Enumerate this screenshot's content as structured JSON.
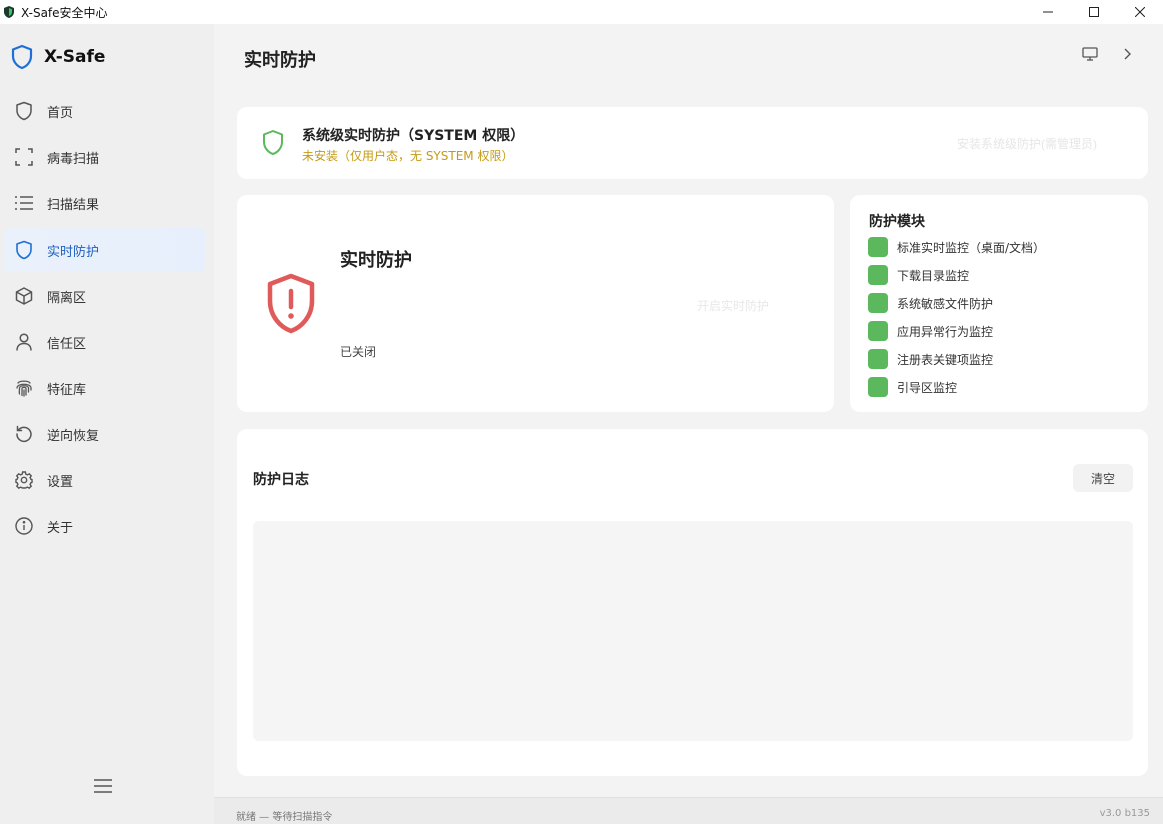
{
  "window": {
    "title": "X-Safe安全中心"
  },
  "brand": {
    "name": "X-Safe"
  },
  "sidebar": {
    "items": [
      {
        "label": "首页",
        "icon": "shield-outline-icon"
      },
      {
        "label": "病毒扫描",
        "icon": "scan-frame-icon"
      },
      {
        "label": "扫描结果",
        "icon": "list-icon"
      },
      {
        "label": "实时防护",
        "icon": "shield-outline-icon",
        "active": true
      },
      {
        "label": "隔离区",
        "icon": "cube-icon"
      },
      {
        "label": "信任区",
        "icon": "person-icon"
      },
      {
        "label": "特征库",
        "icon": "fingerprint-icon"
      },
      {
        "label": "逆向恢复",
        "icon": "undo-icon"
      },
      {
        "label": "设置",
        "icon": "gear-icon"
      },
      {
        "label": "关于",
        "icon": "info-icon"
      }
    ]
  },
  "page": {
    "title": "实时防护"
  },
  "system_protection": {
    "title": "系统级实时防护（SYSTEM 权限）",
    "status": "未安装（仅用户态，无 SYSTEM 权限）",
    "install_label": "安装系统级防护(需管理员)"
  },
  "realtime": {
    "title": "实时防护",
    "enable_label": "开启实时防护",
    "status": "已关闭"
  },
  "modules": {
    "title": "防护模块",
    "items": [
      "标准实时监控（桌面/文档）",
      "下载目录监控",
      "系统敏感文件防护",
      "应用异常行为监控",
      "注册表关键项监控",
      "引导区监控"
    ]
  },
  "log": {
    "title": "防护日志",
    "clear_label": "清空"
  },
  "statusbar": {
    "left": "就绪 — 等待扫描指令",
    "right": "v3.0 b135"
  },
  "colors": {
    "accent": "#1e6fd9",
    "active_bg": "#e8f0fb",
    "warning": "#c49a14",
    "danger": "#e05a5a",
    "success": "#5cb85c",
    "shield_green": "#5cb85c"
  }
}
